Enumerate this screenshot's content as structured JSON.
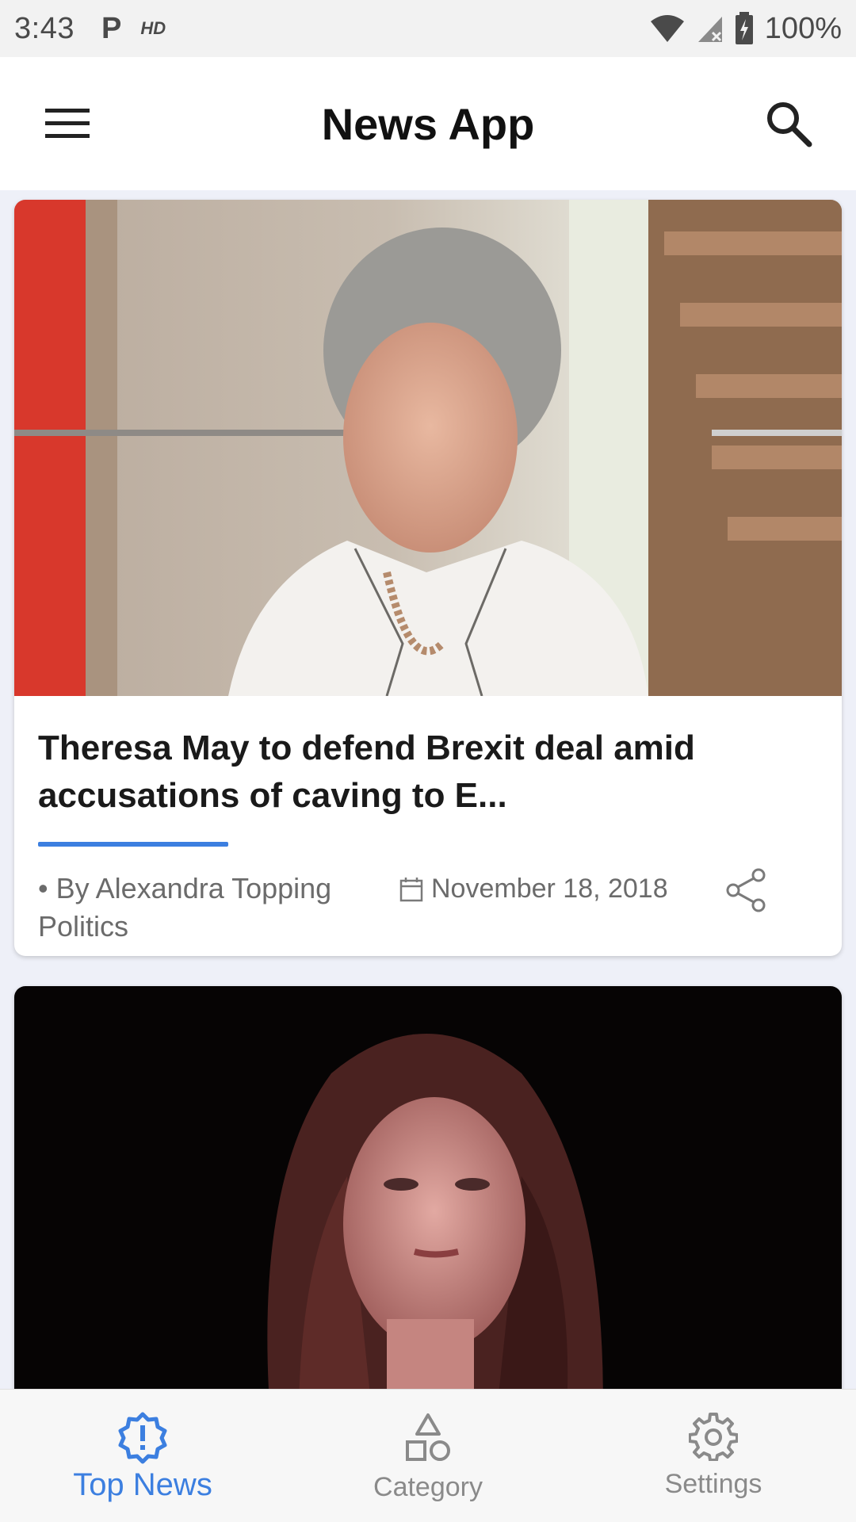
{
  "status_bar": {
    "time": "3:43",
    "p_label": "P",
    "hd_label": "HD",
    "battery": "100%"
  },
  "app_bar": {
    "title": "News App",
    "menu_icon": "hamburger-menu-icon",
    "search_icon": "search-icon"
  },
  "articles": [
    {
      "title": "Theresa May to defend Brexit deal amid accusations of caving to E...",
      "author": "• By Alexandra Topping",
      "category": "Politics",
      "date": "November 18, 2018"
    },
    {
      "title": "",
      "author": "",
      "category": "",
      "date": ""
    }
  ],
  "bottom_nav": {
    "items": [
      {
        "label": "Top News",
        "icon": "alert-badge-icon",
        "active": true
      },
      {
        "label": "Category",
        "icon": "shapes-icon",
        "active": false
      },
      {
        "label": "Settings",
        "icon": "gear-icon",
        "active": false
      }
    ]
  },
  "colors": {
    "accent": "#3c7fe0",
    "background": "#eef0f8"
  }
}
